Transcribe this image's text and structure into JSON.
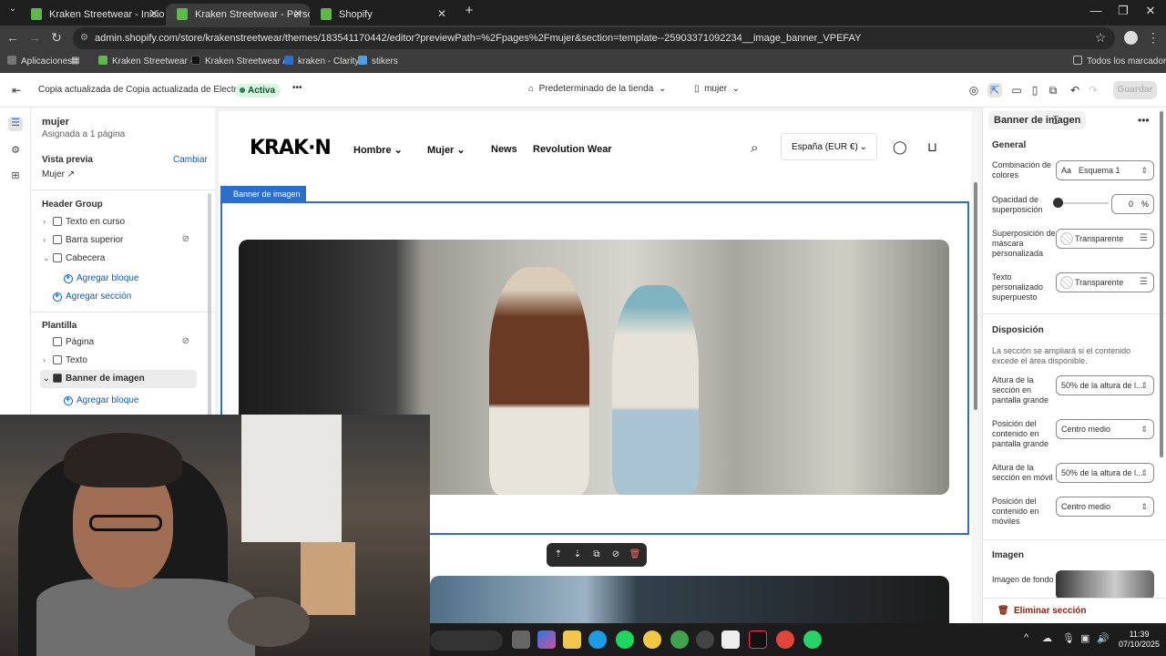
{
  "browser": {
    "tabs": [
      {
        "label": "Kraken Streetwear - Inicio - Shop",
        "active": false
      },
      {
        "label": "Kraken Streetwear - Personaliza",
        "active": true
      },
      {
        "label": "Shopify",
        "active": false
      }
    ],
    "url": "admin.shopify.com/store/krakenstreetwear/themes/183541170442/editor?previewPath=%2Fpages%2Fmujer&section=template--25903371092234__image_banner_VPEFAY",
    "bookmarks": [
      "Aplicaciones",
      "Kraken Streetwear -...",
      "Kraken Streetwear /...",
      "kraken - Clarity",
      "stikers"
    ],
    "all_bookmarks": "Todos los marcadores"
  },
  "editor": {
    "theme_name": "Copia actualizada de Copia actualizada de Electro",
    "status": "Activa",
    "more": "•••",
    "store_default": "Predeterminado de la tienda",
    "page_select": "mujer",
    "save_label": "Guardar"
  },
  "sidebar": {
    "page_title": "mujer",
    "page_sub": "Asignada a 1 página",
    "preview_label": "Vista previa",
    "preview_change": "Cambiar",
    "preview_page": "Mujer",
    "header_group": "Header Group",
    "header_items": [
      {
        "label": "Texto en curso",
        "hidden": false
      },
      {
        "label": "Barra superior",
        "hidden": true
      },
      {
        "label": "Cabecera",
        "hidden": false
      }
    ],
    "add_block": "Agregar bloque",
    "add_section": "Agregar sección",
    "template_title": "Plantilla",
    "template_items": [
      {
        "label": "Página",
        "hidden": true
      },
      {
        "label": "Texto",
        "hidden": false
      },
      {
        "label": "Banner de imagen",
        "hidden": false,
        "selected": true
      }
    ],
    "add_block_2": "Agregar bloque"
  },
  "preview": {
    "logo": "KRAK·N",
    "nav": [
      "Hombre",
      "Mujer",
      "News",
      "Revolution Wear"
    ],
    "country": "España (EUR €)",
    "section_tag": "Banner de imagen"
  },
  "settings": {
    "section_title": "Banner de imagen",
    "general_title": "General",
    "color_scheme_label": "Combinación de colores",
    "color_scheme_value": "Esquema 1",
    "overlay_label": "Opacidad de superposición",
    "overlay_value": "0",
    "overlay_unit": "%",
    "overlay_level": 0,
    "mask_label": "Superposición de máscara personalizada",
    "mask_value": "Transparente",
    "text_label": "Texto personalizado superpuesto",
    "text_value": "Transparente",
    "layout_title": "Disposición",
    "layout_desc": "La sección se ampliará si el contenido excede el área disponible.",
    "height_desktop_label": "Altura de la sección en pantalla grande",
    "height_desktop_value": "50% de la altura de l...",
    "pos_desktop_label": "Posición del contenido en pantalla grande",
    "pos_desktop_value": "Centro medio",
    "height_mobile_label": "Altura de la sección en móvil",
    "height_mobile_value": "50% de la altura de l...",
    "pos_mobile_label": "Posición del contenido en móviles",
    "pos_mobile_value": "Centro medio",
    "image_title": "Imagen",
    "bg_image_label": "Imagen de fondo",
    "delete_label": "Eliminar sección"
  },
  "taskbar": {
    "time": "11:39",
    "date": "07/10/2025"
  },
  "colors": {
    "accent": "#2c6ecb",
    "active_badge": "#d8f5e0",
    "danger": "#8e1f0b"
  }
}
